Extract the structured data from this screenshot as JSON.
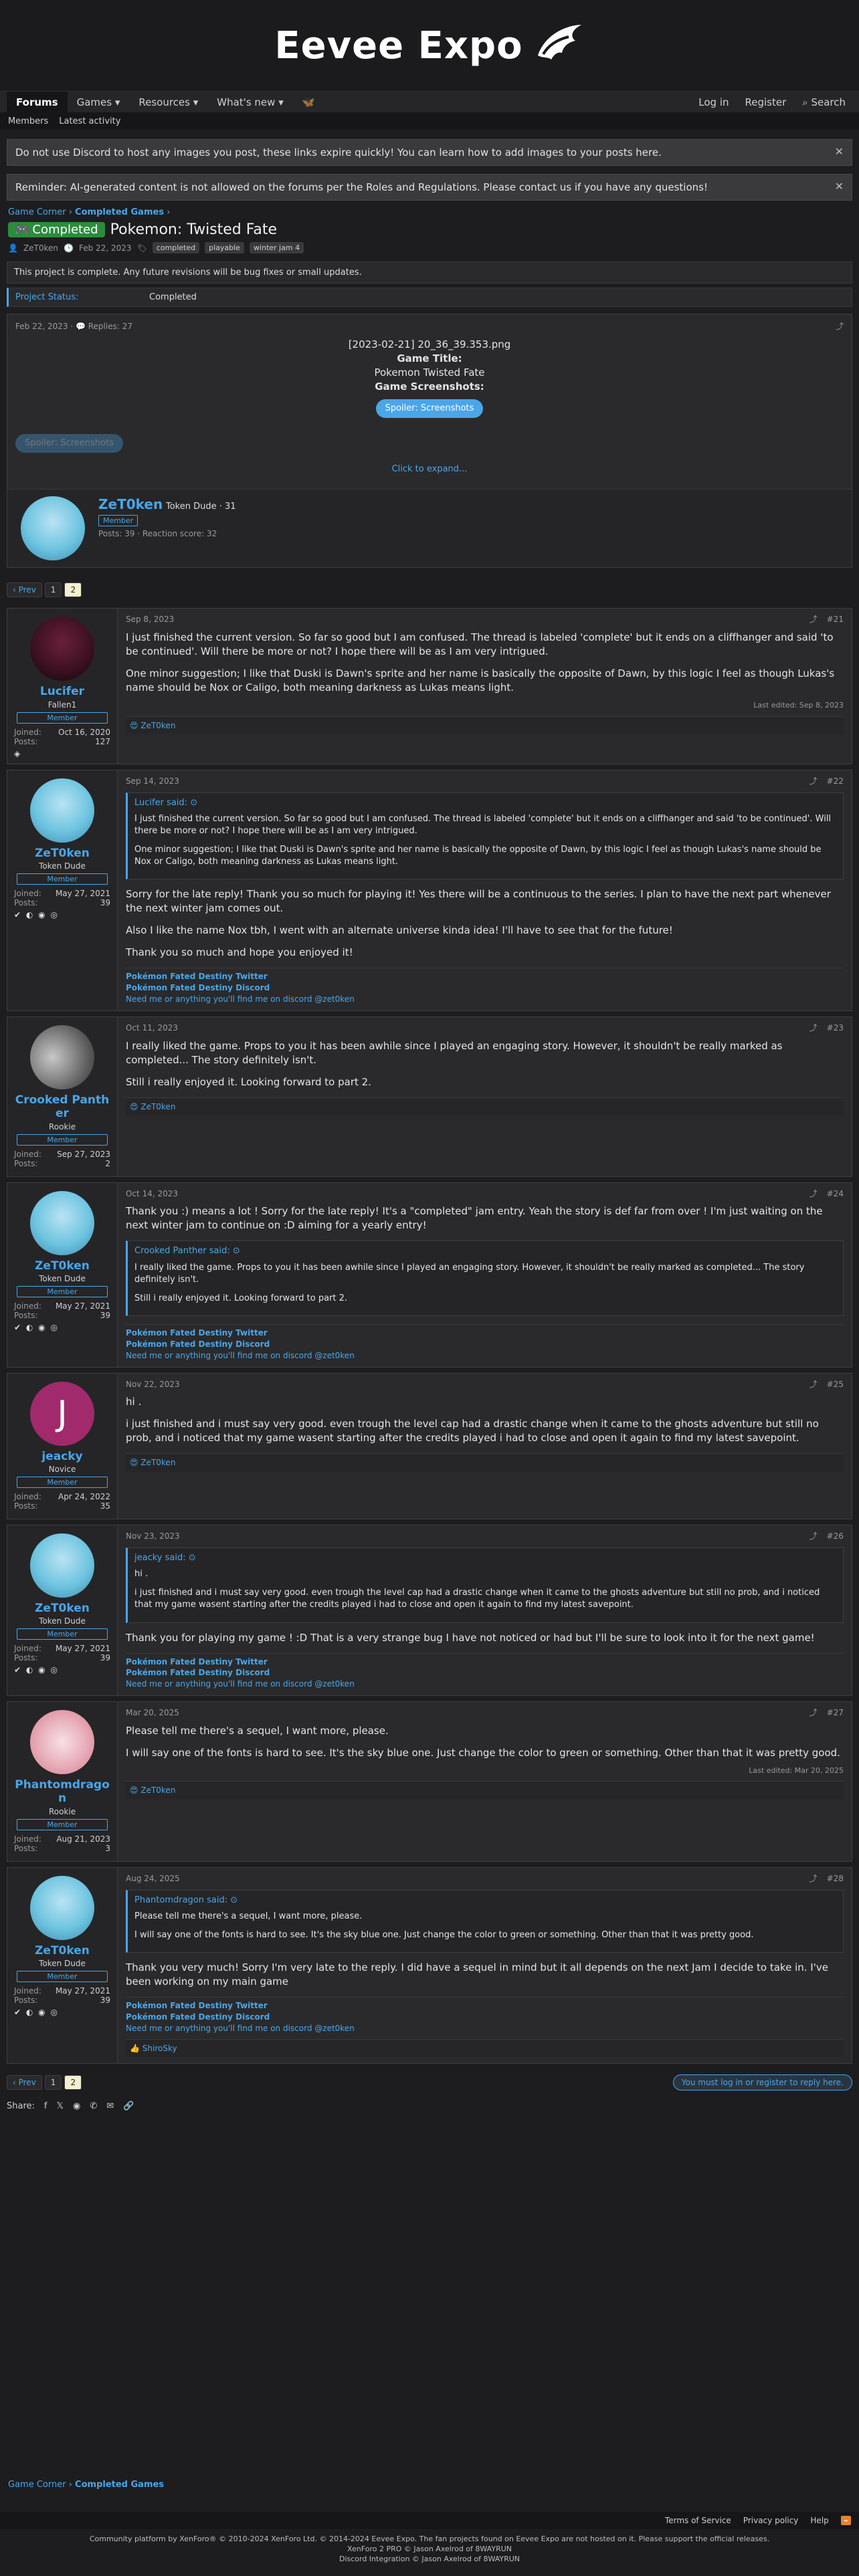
{
  "site": {
    "name": "Eevee Expo"
  },
  "nav": {
    "tabs": [
      "Forums",
      "Games",
      "Resources",
      "What's new"
    ],
    "login": "Log in",
    "register": "Register",
    "search": "Search",
    "sub": [
      "Members",
      "Latest activity"
    ]
  },
  "notices": [
    "Do not use Discord to host any images you post, these links expire quickly! You can learn how to add images to your posts here.",
    "Reminder: AI-generated content is not allowed on the forums per the Roles and Regulations. Please contact us if you have any questions!"
  ],
  "breadcrumb": [
    "Game Corner",
    "Completed Games"
  ],
  "thread": {
    "label": "Completed",
    "title": "Pokemon: Twisted Fate",
    "author": "ZeT0ken",
    "date": "Feb 22, 2023",
    "tags": [
      "completed",
      "playable",
      "winter jam 4"
    ],
    "notice": "This project is complete. Any future revisions will be bug fixes or small updates.",
    "status_key": "Project Status:",
    "status_value": "Completed"
  },
  "op": {
    "date": "Feb 22, 2023",
    "replies": "Replies: 27",
    "image_alt": "[2023-02-21] 20_36_39.353.png",
    "game_title_label": "Game Title:",
    "game_title": "Pokemon Twisted Fate",
    "screenshots_label": "Game Screenshots:",
    "spoiler": "Spoiler: Screenshots",
    "expand": "Click to expand...",
    "author_name": "ZeT0ken",
    "author_title": "Token Dude · 31",
    "author_banner": "Member",
    "author_stats": "Posts: 39 · Reaction score: 32"
  },
  "pagination": {
    "prev": "‹ Prev",
    "pages": [
      "1",
      "2"
    ],
    "current": "2"
  },
  "posts": [
    {
      "user": "Lucifer",
      "title": "Fallen1",
      "banner": "Member",
      "joined": "Oct 16, 2020",
      "posts": "127",
      "date": "Sep 8, 2023",
      "num": "#21",
      "body": [
        "I just finished the current version. So far so good but I am confused. The thread is labeled 'complete' but it ends on a cliffhanger and said 'to be continued'. Will there be more or not? I hope there will be as I am very intrigued.",
        "One minor suggestion; I like that Duski is Dawn's sprite and her name is basically the opposite of Dawn, by this logic I feel as though Lukas's name should be Nox or Caligo, both meaning darkness as Lukas means light."
      ],
      "edited": "Last edited: Sep 8, 2023",
      "reaction": "ZeT0ken"
    },
    {
      "user": "ZeT0ken",
      "title": "Token Dude",
      "banner": "Member",
      "joined": "May 27, 2021",
      "posts": "39",
      "date": "Sep 14, 2023",
      "num": "#22",
      "quote_head": "Lucifer said:",
      "quote": [
        "I just finished the current version. So far so good but I am confused. The thread is labeled 'complete' but it ends on a cliffhanger and said 'to be continued'. Will there be more or not? I hope there will be as I am very intrigued.",
        "One minor suggestion; I like that Duski is Dawn's sprite and her name is basically the opposite of Dawn, by this logic I feel as though Lukas's name should be Nox or Caligo, both meaning darkness as Lukas means light."
      ],
      "body": [
        "Sorry for the late reply! Thank you so much for playing it! Yes there will be a continuous to the series. I plan to have the next part whenever the next winter jam comes out.",
        "Also I like the name Nox tbh, I went with an alternate universe kinda idea! I'll have to see that for the future!",
        "Thank you so much and hope you enjoyed it!"
      ]
    },
    {
      "user": "Crooked Panther",
      "title": "Rookie",
      "banner": "Member",
      "joined": "Sep 27, 2023",
      "posts": "2",
      "date": "Oct 11, 2023",
      "num": "#23",
      "body": [
        "I really liked the game. Props to you it has been awhile since I played an engaging story. However, it shouldn't be really marked as completed... The story definitely isn't.",
        "Still i really enjoyed it. Looking forward to part 2."
      ],
      "reaction": "ZeT0ken"
    },
    {
      "user": "ZeT0ken",
      "title": "Token Dude",
      "banner": "Member",
      "joined": "May 27, 2021",
      "posts": "39",
      "date": "Oct 14, 2023",
      "num": "#24",
      "body": [
        "Thank you :) means a lot ! Sorry for the late reply! It's a \"completed\" jam entry. Yeah the story is def far from over ! I'm just waiting on the next winter jam to continue on :D aiming for a yearly entry!"
      ],
      "quote_head": "Crooked Panther said:",
      "quote": [
        "I really liked the game. Props to you it has been awhile since I played an engaging story. However, it shouldn't be really marked as completed... The story definitely isn't.",
        "Still i really enjoyed it. Looking forward to part 2."
      ]
    },
    {
      "user": "jeacky",
      "title": "Novice",
      "banner": "Member",
      "joined": "Apr 24, 2022",
      "posts": "35",
      "date": "Nov 22, 2023",
      "num": "#25",
      "body": [
        "hi .",
        "i just finished and i must say very good. even trough the level cap had a drastic change when it came to the ghosts adventure but still no prob, and i noticed that my game wasent starting after the credits played i had to close and open it again to find my latest savepoint."
      ],
      "reaction": "ZeT0ken"
    },
    {
      "user": "ZeT0ken",
      "title": "Token Dude",
      "banner": "Member",
      "joined": "May 27, 2021",
      "posts": "39",
      "date": "Nov 23, 2023",
      "num": "#26",
      "quote_head": "jeacky said:",
      "quote": [
        "hi .",
        "i just finished and i must say very good. even trough the level cap had a drastic change when it came to the ghosts adventure but still no prob, and i noticed that my game wasent starting after the credits played i had to close and open it again to find my latest savepoint."
      ],
      "body": [
        "Thank you for playing my game ! :D That is a very strange bug I have not noticed or had but I'll be sure to look into it for the next game!"
      ]
    },
    {
      "user": "Phantomdragon",
      "title": "Rookie",
      "banner": "Member",
      "joined": "Aug 21, 2023",
      "posts": "3",
      "date": "Mar 20, 2025",
      "num": "#27",
      "body": [
        "Please tell me there's a sequel, I want more, please.",
        "I will say one of the fonts is hard to see. It's the sky blue one. Just change the color to green or something. Other than that it was pretty good."
      ],
      "edited": "Last edited: Mar 20, 2025",
      "reaction": "ZeT0ken"
    },
    {
      "user": "ZeT0ken",
      "title": "Token Dude",
      "banner": "Member",
      "joined": "May 27, 2021",
      "posts": "39",
      "date": "Aug 24, 2025",
      "num": "#28",
      "quote_head": "Phantomdragon said:",
      "quote": [
        "Please tell me there's a sequel, I want more, please.",
        "I will say one of the fonts is hard to see. It's the sky blue one. Just change the color to green or something. Other than that it was pretty good."
      ],
      "body": [
        "Thank you very much! Sorry I'm very late to the reply. I did have a sequel in mind but it all depends on the next Jam I decide to take in. I've been working on my main game"
      ],
      "reaction": "ShiroSky"
    }
  ],
  "signature": {
    "l1": "Pokémon Fated Destiny Twitter",
    "l2": "Pokémon Fated Destiny Discord",
    "l3": "Need me or anything you'll find me on discord @zet0ken"
  },
  "labels": {
    "joined": "Joined:",
    "posts": "Posts:"
  },
  "login_prompt": "You must log in or register to reply here.",
  "share": "Share:",
  "footer": {
    "links": [
      "Terms of Service",
      "Privacy policy",
      "Help"
    ],
    "credits": [
      "Community platform by XenForo® © 2010-2024 XenForo Ltd. © 2014-2024 Eevee Expo. The fan projects found on Eevee Expo are not hosted on it. Please support the official releases.",
      "XenForo 2 PRO © Jason Axelrod of 8WAYRUN",
      "Discord Integration © Jason Axelrod of 8WAYRUN"
    ]
  }
}
